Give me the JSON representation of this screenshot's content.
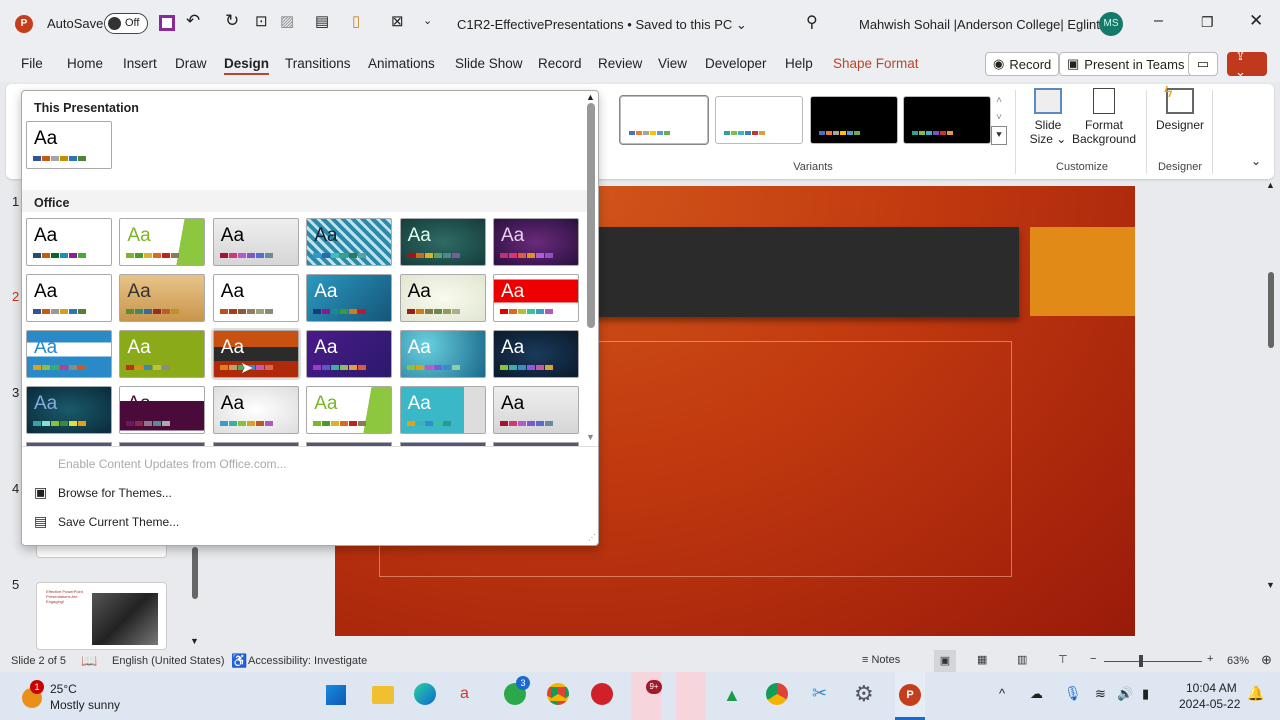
{
  "titlebar": {
    "autosave": "AutoSave",
    "toggle": "Off",
    "doc_title": "C1R2-EffectivePresentations • Saved to this PC ⌄",
    "user": "Mahwish Sohail |Anderson College| Eglinton",
    "initials": "MS"
  },
  "tabs": [
    "File",
    "Home",
    "Insert",
    "Draw",
    "Design",
    "Transitions",
    "Animations",
    "Slide Show",
    "Record",
    "Review",
    "View",
    "Developer",
    "Help",
    "Shape Format"
  ],
  "ribbon_buttons": {
    "record": "Record",
    "present": "Present in Teams"
  },
  "ribbon": {
    "variants_label": "Variants",
    "slide_size": "Slide",
    "slide_size2": "Size ⌄",
    "format_bg": "Format",
    "format_bg2": "Background",
    "customize_label": "Customize",
    "designer": "Designer",
    "designer_label": "Designer",
    "variants": [
      {
        "bg": "#ffffff",
        "swatches": [
          "#4472c4",
          "#ed7d31",
          "#a5a5a5",
          "#ffc000",
          "#5b9bd5",
          "#70ad47"
        ]
      },
      {
        "bg": "#ffffff",
        "swatches": [
          "#2ca58d",
          "#84bc4b",
          "#3eb1c8",
          "#3b7fc4",
          "#c0392b",
          "#e39b3b"
        ]
      },
      {
        "bg": "#000000",
        "swatches": [
          "#4472c4",
          "#ed7d31",
          "#a5a5a5",
          "#ffc000",
          "#5b9bd5",
          "#70ad47"
        ]
      },
      {
        "bg": "#000000",
        "swatches": [
          "#2ca58d",
          "#84bc4b",
          "#3eb1c8",
          "#7d4fc4",
          "#c0392b",
          "#e39b3b"
        ]
      }
    ]
  },
  "gallery": {
    "this_presentation": "This Presentation",
    "office": "Office",
    "aa": "Aa",
    "current": {
      "bg": "#ffffff",
      "fg": "#000",
      "swatches": [
        "#2f5597",
        "#c55a11",
        "#a5a5a5",
        "#bf9000",
        "#2e75b6",
        "#548235"
      ]
    },
    "themes": [
      {
        "bg": "#ffffff",
        "fg": "#000",
        "swatches": [
          "#1f4e79",
          "#c55a11",
          "#0b6623",
          "#1f8bb8",
          "#8e1e9e",
          "#4aa832"
        ]
      },
      {
        "bg": "linear-gradient(100deg,#fff 70%,#8dc63f 70%)",
        "fg": "#7ab52a",
        "swatches": [
          "#7ab52a",
          "#4a9b2a",
          "#d8b42a",
          "#d86a1a",
          "#c0211a",
          "#8a7a5a"
        ]
      },
      {
        "bg": "linear-gradient(#eee,#d6d6d6)",
        "fg": "#000",
        "swatches": [
          "#a3152e",
          "#d5386e",
          "#b35ad0",
          "#7a5ac8",
          "#5a6ad0",
          "#6a8aa0"
        ]
      },
      {
        "bg": "repeating-linear-gradient(45deg,#2a8aa8 0 4px,#bfe2ee 4px 7px)",
        "fg": "#123",
        "swatches": [
          "#2a9ad0",
          "#2a6ab0",
          "#3ac0c0",
          "#3aa08a",
          "#2a7a5a",
          "#5aa0a0"
        ]
      },
      {
        "bg": "radial-gradient(#2f6b66,#153d3a)",
        "fg": "#dfe",
        "swatches": [
          "#a01515",
          "#d06a1a",
          "#e0b020",
          "#5aa06a",
          "#4a8a8a",
          "#7a5a9a"
        ]
      },
      {
        "bg": "radial-gradient(#6a2a7a,#2a1040)",
        "fg": "#e8d0f0",
        "swatches": [
          "#c0306a",
          "#e0307a",
          "#e05a3a",
          "#e0902a",
          "#b05ae0",
          "#9a4ad0"
        ]
      },
      {
        "bg": "#ffffff",
        "fg": "#000",
        "swatches": [
          "#2f5597",
          "#c55a11",
          "#999",
          "#d4a017",
          "#2e75b6",
          "#548235"
        ]
      },
      {
        "bg": "linear-gradient(#e8c48a,#c8964a)",
        "fg": "#333",
        "swatches": [
          "#5a8a3a",
          "#3a8a6a",
          "#3a6a9a",
          "#9a2a2a",
          "#c05a2a",
          "#c0902a"
        ]
      },
      {
        "bg": "#ffffff",
        "fg": "#000",
        "swatches": [
          "#c0501a",
          "#a0401a",
          "#8a5a3a",
          "#9a7a5a",
          "#a0a07a",
          "#8a8a7a"
        ]
      },
      {
        "bg": "linear-gradient(135deg,#2a9ac0,#16557a)",
        "fg": "#fff",
        "swatches": [
          "#1a3a7a",
          "#8a1a8a",
          "#1a8a8a",
          "#3a9a3a",
          "#d07a1a",
          "#c01a2a"
        ]
      },
      {
        "bg": "radial-gradient(#fafaf0,#e0e6d0)",
        "fg": "#000",
        "swatches": [
          "#a01a1a",
          "#d07a1a",
          "#8a7a4a",
          "#6a8a4a",
          "#8aa05a",
          "#aab08a"
        ]
      },
      {
        "bg": "linear-gradient(#fff 10%,#e00 10% 60%,#fff 60%)",
        "fg": "#fff",
        "swatches": [
          "#e00000",
          "#e06a1a",
          "#b0c03a",
          "#3ac09a",
          "#3aa0c0",
          "#b05ac0"
        ]
      },
      {
        "bg": "linear-gradient(#2a8ac8 25%,#fff 25% 55%,#2a8ac8 55%)",
        "fg": "#2a8ac8",
        "swatches": [
          "#e0a01a",
          "#8ac03a",
          "#3ab05a",
          "#c03a9a",
          "#8a8a8a",
          "#d05a1a"
        ]
      },
      {
        "bg": "#8aaa1a",
        "fg": "#fff",
        "swatches": [
          "#c0301a",
          "#e08a1a",
          "#3a8ab0",
          "#c0c03a",
          "#8a8a8a"
        ]
      },
      {
        "bg": "linear-gradient(#c85010 35%,#2b2b2b 35% 65%,#b02a0a 65%)",
        "fg": "#fff",
        "swatches": [
          "#e0801a",
          "#c0a06a",
          "#3ab06a",
          "#3a8ac0",
          "#c05ac0",
          "#d06a5a"
        ]
      },
      {
        "bg": "linear-gradient(135deg,#4a1a8a,#2a1a6a)",
        "fg": "#fff",
        "swatches": [
          "#a03ac0",
          "#5a5ac0",
          "#3ab0a0",
          "#8ac05a",
          "#e0a03a",
          "#e05a3a"
        ]
      },
      {
        "bg": "radial-gradient(circle at 30% 30%,#6ad0e0,#1a6a8a)",
        "fg": "#fff",
        "swatches": [
          "#8ac03a",
          "#e0a01a",
          "#c05ac0",
          "#7a5ae0",
          "#3a8ad0",
          "#8ad0a0"
        ]
      },
      {
        "bg": "radial-gradient(#1a3a5a,#0a1a2a)",
        "fg": "#fff",
        "swatches": [
          "#8ac03a",
          "#3ab0a0",
          "#3a8ad0",
          "#8a5ae0",
          "#c05aa0",
          "#e0a03a"
        ]
      },
      {
        "bg": "radial-gradient(#1a5a6a,#0a2a3a)",
        "fg": "#8ad",
        "swatches": [
          "#3aa0a0",
          "#8ae0d0",
          "#8ac03a",
          "#3a8a3a",
          "#e0e03a",
          "#e0a01a"
        ]
      },
      {
        "bg": "linear-gradient(#fff 30%,#4a0a3a 30% 95%,#fff 95%)",
        "fg": "#4a0a3a",
        "swatches": [
          "#6a1a5a",
          "#8a2a4a",
          "#8a7a8a",
          "#5a8a9a",
          "#aaa"
        ]
      },
      {
        "bg": "radial-gradient(#fff,#ddd)",
        "fg": "#000",
        "swatches": [
          "#3a9ad0",
          "#3ab0a0",
          "#8ac03a",
          "#e0a01a",
          "#c05a1a",
          "#b05ac0"
        ]
      },
      {
        "bg": "linear-gradient(100deg,#fff 70%,#8dc63f 70%)",
        "fg": "#7ab52a",
        "swatches": [
          "#7ab52a",
          "#4a9b2a",
          "#d8b42a",
          "#d86a1a",
          "#c0211a",
          "#8a7a5a"
        ]
      },
      {
        "bg": "linear-gradient(90deg,#3ab8c8 75%,#ddd 75%)",
        "fg": "#fff",
        "swatches": [
          "#e0a01a",
          "#3ab0c0",
          "#3a8ad0",
          "#3ac0a0",
          "#2a9a8a"
        ]
      },
      {
        "bg": "linear-gradient(#eee,#d6d6d6)",
        "fg": "#000",
        "swatches": [
          "#a3152e",
          "#d5386e",
          "#b35ad0",
          "#7a5ac8",
          "#5a6ad0",
          "#6a8aa0"
        ]
      }
    ],
    "enable_updates": "Enable Content Updates from Office.com...",
    "browse": "Browse for Themes...",
    "save": "Save Current Theme..."
  },
  "slides": {
    "numbers": [
      "1",
      "2",
      "3",
      "4",
      "5"
    ],
    "slide5_title": "Effective PowerPoint Presentations Are Engaging!"
  },
  "statusbar": {
    "slide": "Slide 2 of 5",
    "language": "English (United States)",
    "accessibility": "Accessibility: Investigate",
    "notes": "Notes",
    "zoom": "63%",
    "zoom_fraction": 0.38
  },
  "taskbar": {
    "temp": "25°C",
    "weather": "Mostly sunny",
    "weather_badge": "1",
    "time": "10:04 AM",
    "date": "2024-05-22",
    "whatsapp_badge": "3",
    "teams_badge": "9+"
  }
}
